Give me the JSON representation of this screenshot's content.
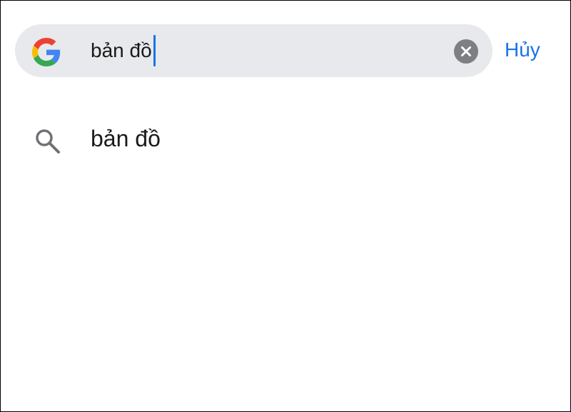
{
  "search_bar": {
    "logo_icon": "google-g-icon",
    "query_value": "bản đồ",
    "clear_icon": "clear-x-icon",
    "cancel_label": "Hủy"
  },
  "suggestions": [
    {
      "icon": "search-icon",
      "text": "bản đồ"
    }
  ],
  "colors": {
    "search_pill_bg": "#e8e9ec",
    "accent_blue": "#1a73e8",
    "clear_button_bg": "#7d7f84",
    "text": "#1a1a1a",
    "google_blue": "#4285F4",
    "google_red": "#EA4335",
    "google_yellow": "#FBBC05",
    "google_green": "#34A853"
  }
}
